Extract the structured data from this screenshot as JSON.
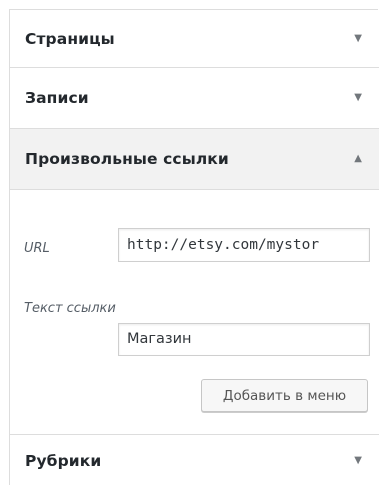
{
  "accordion": {
    "pages": {
      "title": "Страницы",
      "arrow": "▼"
    },
    "posts": {
      "title": "Записи",
      "arrow": "▼"
    },
    "custom_links": {
      "title": "Произвольные ссылки",
      "arrow": "▲",
      "url_label": "URL",
      "url_value": "http://etsy.com/mystor",
      "link_text_label": "Текст ссылки",
      "link_text_value": "Магазин",
      "add_button_label": "Добавить в меню"
    },
    "categories": {
      "title": "Рубрики",
      "arrow": "▼"
    }
  },
  "colors": {
    "active_header_bg": "#f2f2f2",
    "border": "#dddddd",
    "arrow": "#72777c"
  }
}
